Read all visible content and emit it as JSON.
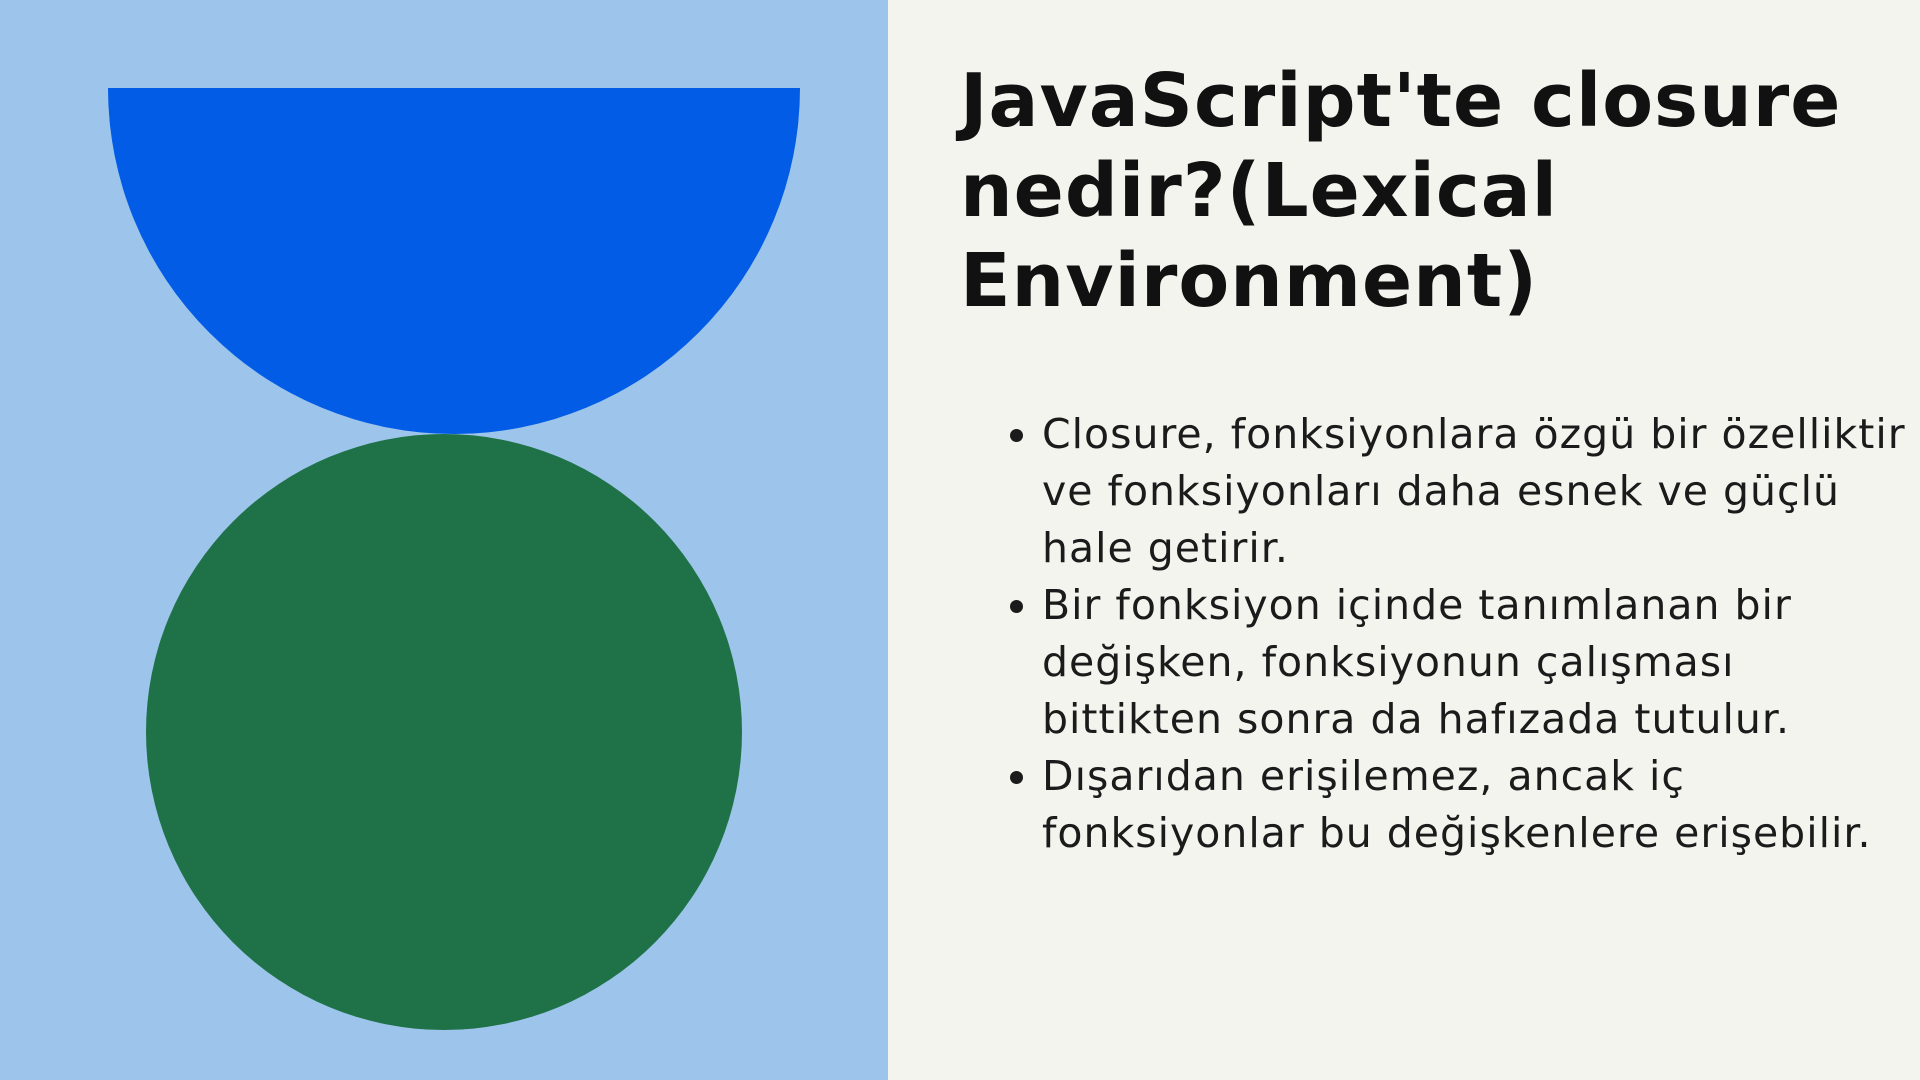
{
  "colors": {
    "background": "#f4f4ef",
    "left_panel": "#9dc5eb",
    "half_circle": "#025ce5",
    "full_circle": "#1f7147",
    "text": "#111111"
  },
  "title": "JavaScript'te closure nedir?(Lexical Environment)",
  "bullets": [
    "Closure, fonksiyonlara özgü bir özelliktir ve fonksiyonları daha esnek ve güçlü hale getirir.",
    "Bir fonksiyon içinde tanımlanan bir değişken, fonksiyonun çalışması bittikten sonra da hafızada tutulur.",
    " Dışarıdan erişilemez, ancak iç fonksiyonlar bu değişkenlere erişebilir."
  ]
}
